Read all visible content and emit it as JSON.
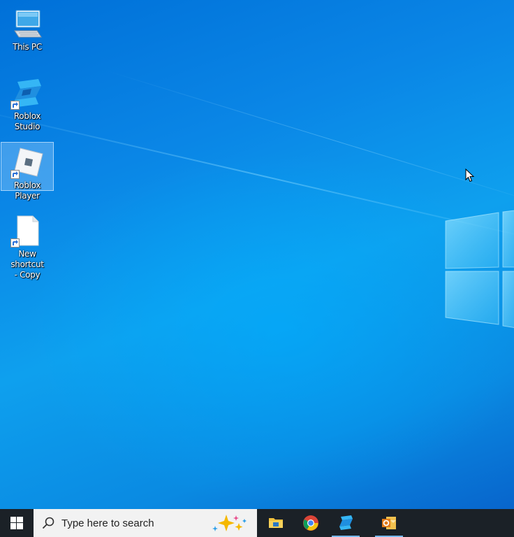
{
  "desktop": {
    "icons": [
      {
        "label": "This PC",
        "icon": "computer-icon",
        "shortcut": false,
        "selected": false
      },
      {
        "label": "Roblox Studio",
        "icon": "roblox-studio-icon",
        "shortcut": true,
        "selected": false
      },
      {
        "label": "Roblox Player",
        "icon": "roblox-player-icon",
        "shortcut": true,
        "selected": true
      },
      {
        "label": "New shortcut\n- Copy",
        "icon": "blank-file-icon",
        "shortcut": true,
        "selected": false
      }
    ]
  },
  "taskbar": {
    "start_icon": "windows-logo-icon",
    "search": {
      "placeholder": "Type here to search",
      "icon": "search-icon",
      "copilot_icon": "copilot-sparkle-icon"
    },
    "apps": [
      {
        "name": "File Explorer",
        "icon": "file-explorer-icon",
        "running": false
      },
      {
        "name": "Google Chrome",
        "icon": "chrome-icon",
        "running": false
      },
      {
        "name": "Roblox Studio",
        "icon": "roblox-studio-icon",
        "running": true
      },
      {
        "name": "Outlook",
        "icon": "outlook-icon",
        "running": true
      }
    ],
    "colors": {
      "background": "#1b2127",
      "running_indicator": "#76b9ed"
    }
  },
  "colors": {
    "desktop_blue": "#0a86e6",
    "selection": "#add6ff"
  }
}
